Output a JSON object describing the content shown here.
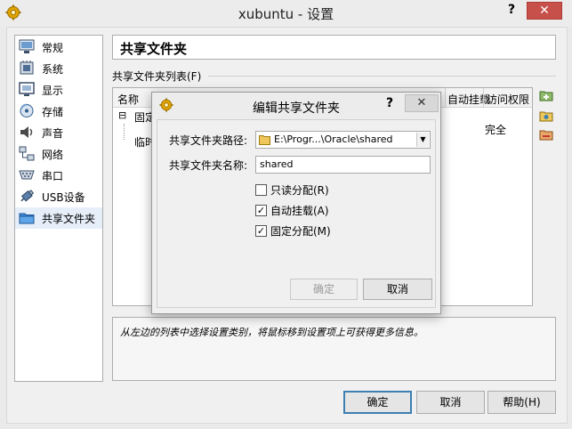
{
  "window": {
    "title": "xubuntu - 设置",
    "help_glyph": "?",
    "close_glyph": "✕"
  },
  "sidebar": {
    "items": [
      {
        "label": "常规",
        "icon": "general-icon"
      },
      {
        "label": "系统",
        "icon": "system-icon"
      },
      {
        "label": "显示",
        "icon": "display-icon"
      },
      {
        "label": "存储",
        "icon": "storage-icon"
      },
      {
        "label": "声音",
        "icon": "audio-icon"
      },
      {
        "label": "网络",
        "icon": "network-icon"
      },
      {
        "label": "串口",
        "icon": "serial-port-icon"
      },
      {
        "label": "USB设备",
        "icon": "usb-icon"
      },
      {
        "label": "共享文件夹",
        "icon": "shared-folder-icon",
        "selected": true
      }
    ]
  },
  "main": {
    "title": "共享文件夹",
    "list_label": "共享文件夹列表(F)",
    "table": {
      "columns": [
        "名称",
        "自动挂载",
        "访问权限"
      ],
      "rows": [
        {
          "expander": "⊟",
          "name": "固定",
          "access": ""
        },
        {
          "name": "临时",
          "access": "完全"
        }
      ]
    },
    "info_text": "从左边的列表中选择设置类别，将鼠标移到设置项上可获得更多信息。"
  },
  "dialog": {
    "title": "编辑共享文件夹",
    "help_glyph": "?",
    "close_glyph": "✕",
    "path_label": "共享文件夹路径:",
    "path_value": "E:\\Progr...\\Oracle\\shared",
    "name_label": "共享文件夹名称:",
    "name_value": "shared",
    "checkboxes": [
      {
        "label": "只读分配(R)",
        "checked": false,
        "mark": ""
      },
      {
        "label": "自动挂载(A)",
        "checked": true,
        "mark": "✓"
      },
      {
        "label": "固定分配(M)",
        "checked": true,
        "mark": "✓"
      }
    ],
    "ok_label": "确定",
    "cancel_label": "取消"
  },
  "footer": {
    "ok_label": "确定",
    "cancel_label": "取消",
    "help_label": "帮助(H)"
  },
  "colors": {
    "close_red": "#c7504a",
    "selection": "#e5eef9",
    "default_border": "#3c7fb1"
  }
}
